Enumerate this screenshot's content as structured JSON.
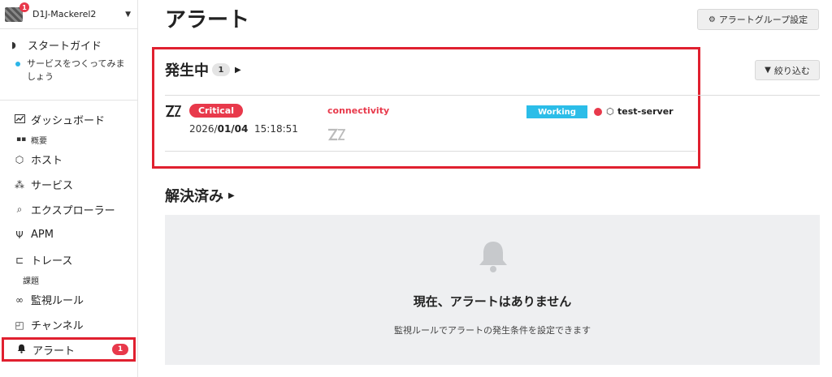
{
  "sidebar": {
    "org_name": "D1J-Mackerel2",
    "org_badge": "1",
    "guide_title": "スタートガイド",
    "guide_sub": "サービスをつくってみましょう",
    "items": {
      "dashboard": "ダッシュボード",
      "overview": "概要",
      "hosts": "ホスト",
      "services": "サービス",
      "explorer": "エクスプローラー",
      "apm": "APM",
      "trace": "トレース",
      "issues": "課題",
      "monitors": "監視ルール",
      "channels": "チャンネル",
      "alerts": "アラート"
    },
    "alert_count": "1"
  },
  "main": {
    "title": "アラート",
    "group_settings_label": "アラートグループ設定",
    "filter_label": "絞り込む",
    "open_section": {
      "title": "発生中",
      "count": "1"
    },
    "alert": {
      "severity": "Critical",
      "date_prefix": "2026/",
      "date_bold": "01/04",
      "time": "15:18:51",
      "monitor": "connectivity",
      "status": "Working",
      "host": "test-server"
    },
    "resolved_section": {
      "title": "解決済み"
    },
    "empty": {
      "title": "現在、アラートはありません",
      "subtitle": "監視ルールでアラートの発生条件を設定できます"
    }
  },
  "colors": {
    "critical": "#e8394b",
    "working": "#2bbde8",
    "highlight": "#e0202f"
  }
}
